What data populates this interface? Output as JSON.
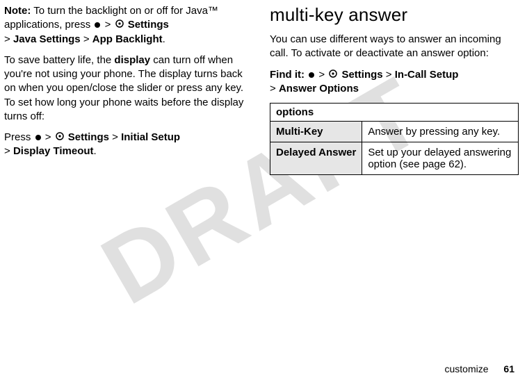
{
  "watermark": "DRAFT",
  "left": {
    "note_label": "Note:",
    "note_text_1": " To turn the backlight on or off for Java™ applications, press ",
    "nav1_a": "Settings",
    "nav1_b": "Java Settings",
    "nav1_c": "App Backlight",
    "para2_a": "To save battery life, the ",
    "para2_bold": "display",
    "para2_b": " can turn off when you're not using your phone. The display turns back on when you open/close the slider or press any key. To set how long your phone waits before the display turns off:",
    "para3_a": "Press ",
    "nav2_a": "Settings",
    "nav2_b": "Initial Setup",
    "nav2_c": "Display Timeout"
  },
  "right": {
    "heading": "multi-key answer",
    "intro": "You can use different ways to answer an incoming call. To activate or deactivate an answer option:",
    "findit_label": "Find it:",
    "nav_a": "Settings",
    "nav_b": "In-Call Setup",
    "nav_c": "Answer Options",
    "table": {
      "header": "options",
      "rows": [
        {
          "name": "Multi-Key",
          "desc": "Answer by pressing any key."
        },
        {
          "name": "Delayed Answer",
          "desc": "Set up your delayed answering option (see page 62)."
        }
      ]
    }
  },
  "footer": {
    "label": "customize",
    "page": "61"
  },
  "gt": ">"
}
